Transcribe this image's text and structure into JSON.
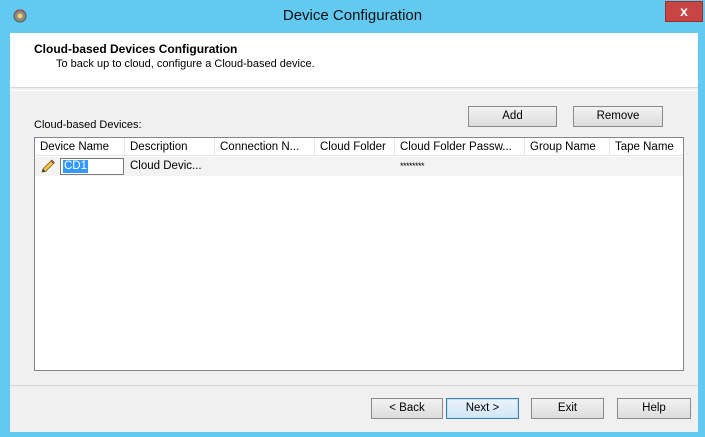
{
  "window": {
    "title": "Device Configuration",
    "close_glyph": "x",
    "icon": "gear-icon"
  },
  "header": {
    "title": "Cloud-based Devices Configuration",
    "subtitle": "To back up to cloud, configure a Cloud-based device."
  },
  "devices": {
    "label": "Cloud-based Devices:",
    "add_label": "Add",
    "remove_label": "Remove",
    "columns": [
      "Device Name",
      "Description",
      "Connection N...",
      "Cloud Folder",
      "Cloud Folder Passw...",
      "Group Name",
      "Tape Name"
    ],
    "rows": [
      {
        "icon": "pencil-icon",
        "device_name": "CD1",
        "description": "Cloud Devic...",
        "connection": "",
        "cloud_folder": "",
        "password": "********",
        "group_name": "",
        "tape_name": ""
      }
    ]
  },
  "footer": {
    "back_label": "< Back",
    "next_label": "Next >",
    "exit_label": "Exit",
    "help_label": "Help"
  }
}
